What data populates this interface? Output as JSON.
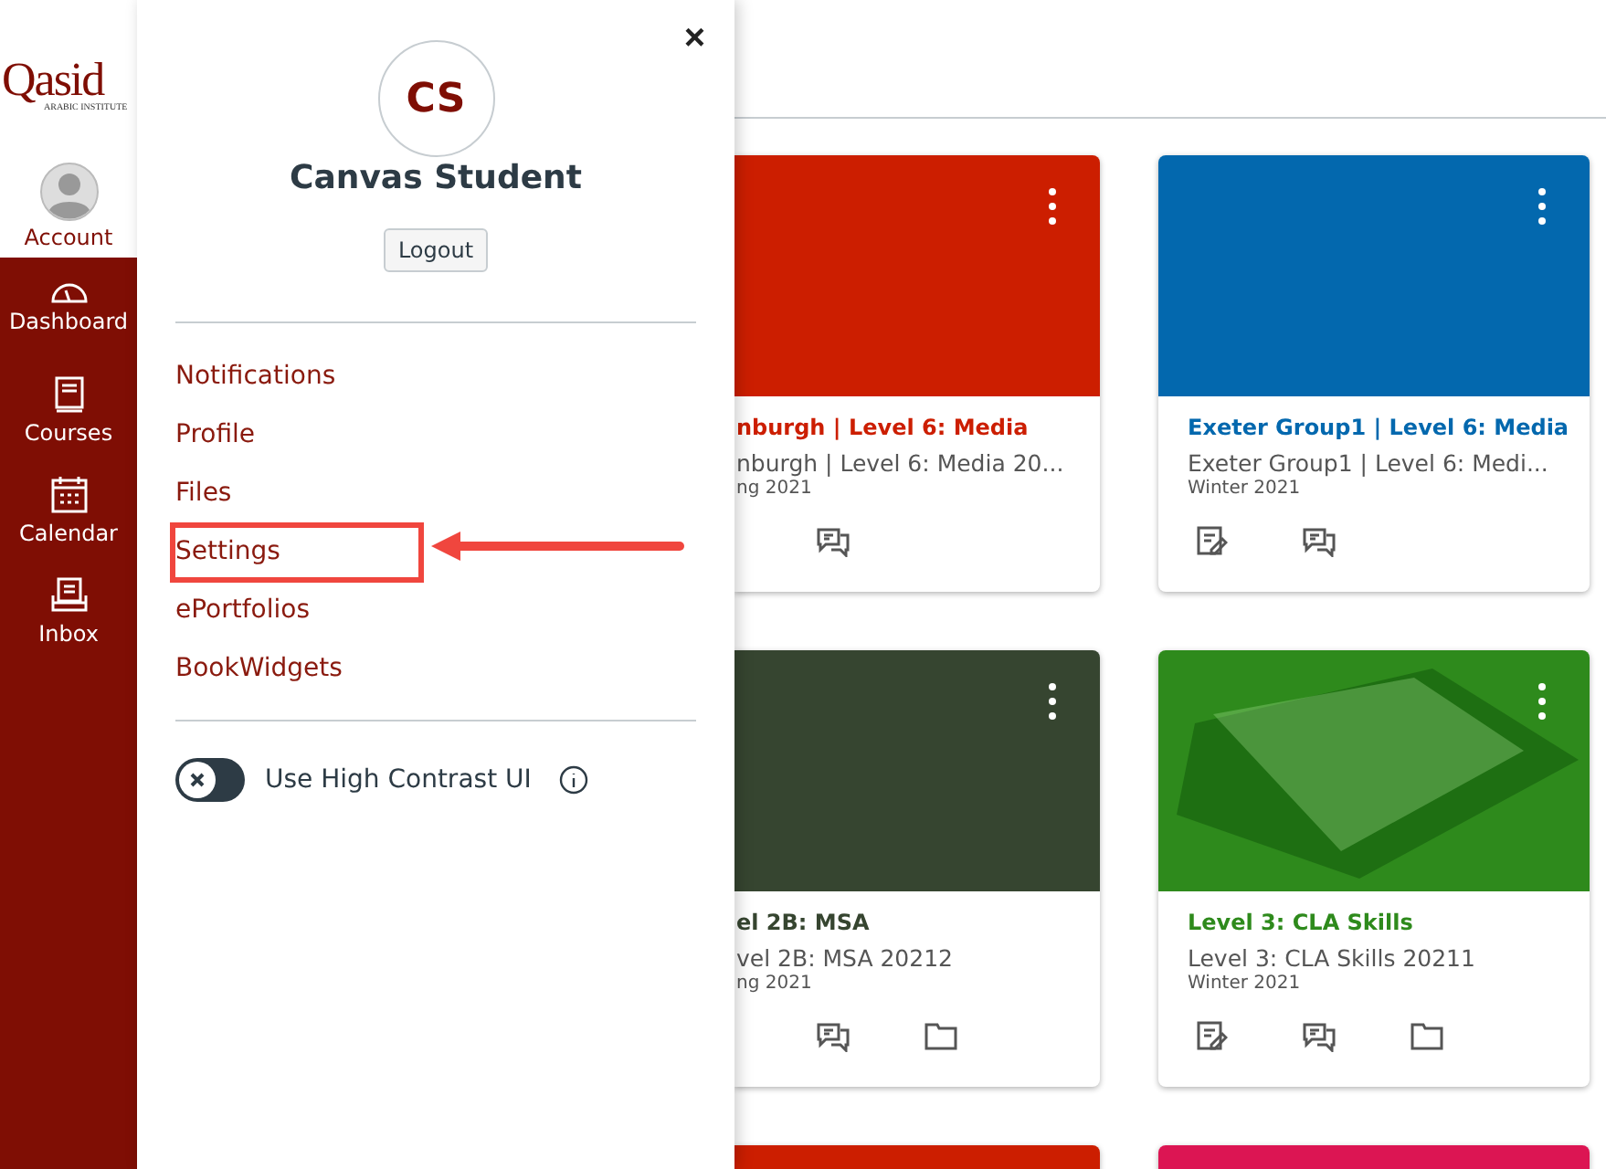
{
  "logo": {
    "name": "Qasid",
    "tagline": "ARABIC INSTITUTE"
  },
  "nav": [
    {
      "label": "Account",
      "selected": true
    },
    {
      "label": "Dashboard",
      "selected": false
    },
    {
      "label": "Courses",
      "selected": false
    },
    {
      "label": "Calendar",
      "selected": false
    },
    {
      "label": "Inbox",
      "selected": false
    }
  ],
  "tray": {
    "close": "×",
    "initials": "CS",
    "name": "Canvas Student",
    "logout": "Logout",
    "links": [
      {
        "label": "Notifications",
        "highlighted": false
      },
      {
        "label": "Profile",
        "highlighted": false
      },
      {
        "label": "Files",
        "highlighted": false
      },
      {
        "label": "Settings",
        "highlighted": true
      },
      {
        "label": "ePortfolios",
        "highlighted": false
      },
      {
        "label": "BookWidgets",
        "highlighted": false
      }
    ],
    "high_contrast": {
      "label": "Use High Contrast UI",
      "on": false
    }
  },
  "cards": [
    {
      "kind": "color",
      "color": "#cc1e00",
      "title": "nburgh | Level 6: Media",
      "subtitle": "nburgh | Level 6: Media 20...",
      "term": "ng 2021"
    },
    {
      "kind": "color",
      "color": "#0368ae",
      "title": "Exeter Group1 | Level 6: Media",
      "subtitle": "Exeter Group1 | Level 6: Medi...",
      "term": "Winter 2021"
    },
    {
      "kind": "color",
      "color": "#364530",
      "title": "el 2B: MSA",
      "subtitle": "vel 2B: MSA 20212",
      "term": "ng 2021"
    },
    {
      "kind": "photo",
      "color": "#2e8a1c",
      "title": "Level 3: CLA Skills",
      "subtitle": "Level 3: CLA Skills 20211",
      "term": "Winter 2021"
    },
    {
      "kind": "color",
      "color": "#cc1e00"
    },
    {
      "kind": "color",
      "color": "#dc1553"
    }
  ]
}
